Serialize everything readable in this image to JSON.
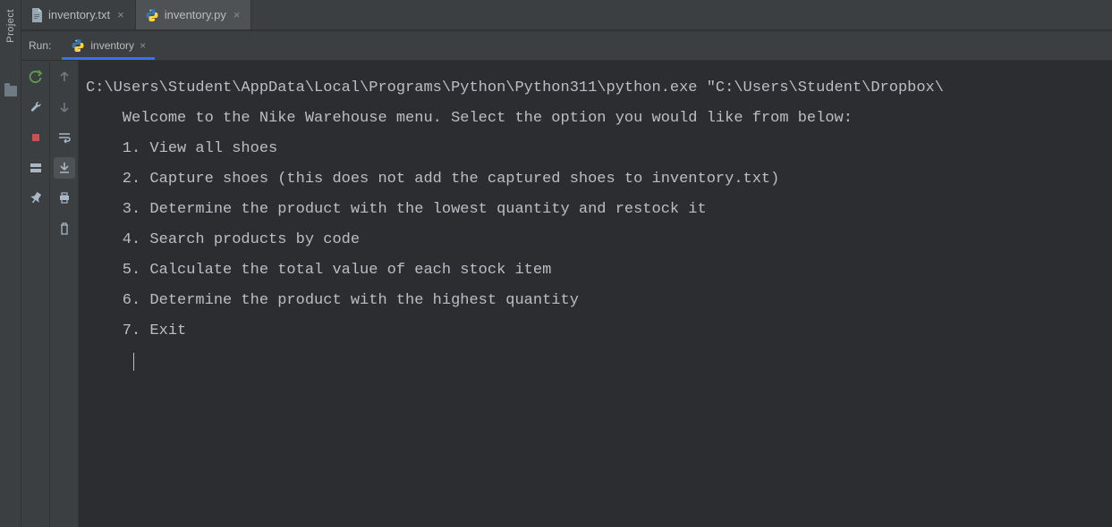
{
  "projectBar": {
    "label": "Project"
  },
  "editorTabs": [
    {
      "label": "inventory.txt",
      "active": false,
      "iconType": "txt"
    },
    {
      "label": "inventory.py",
      "active": true,
      "iconType": "py"
    }
  ],
  "runPanel": {
    "label": "Run:",
    "tab": {
      "label": "inventory",
      "iconType": "py"
    }
  },
  "console": {
    "lines": [
      "C:\\Users\\Student\\AppData\\Local\\Programs\\Python\\Python311\\python.exe \"C:\\Users\\Student\\Dropbox\\",
      "",
      "    Welcome to the Nike Warehouse menu. Select the option you would like from below:",
      "    1. View all shoes",
      "    2. Capture shoes (this does not add the captured shoes to inventory.txt)",
      "    3. Determine the product with the lowest quantity and restock it",
      "    4. Search products by code",
      "    5. Calculate the total value of each stock item",
      "    6. Determine the product with the highest quantity",
      "    7. Exit"
    ]
  },
  "iconColors": {
    "rerun": "#5b9e4d",
    "stop": "#c75450",
    "arrow": "#8a8d8f",
    "wrench": "#a9b7c6",
    "grey": "#8a8d8f",
    "pyBlue": "#3776ab",
    "pyYellow": "#ffd43b"
  }
}
